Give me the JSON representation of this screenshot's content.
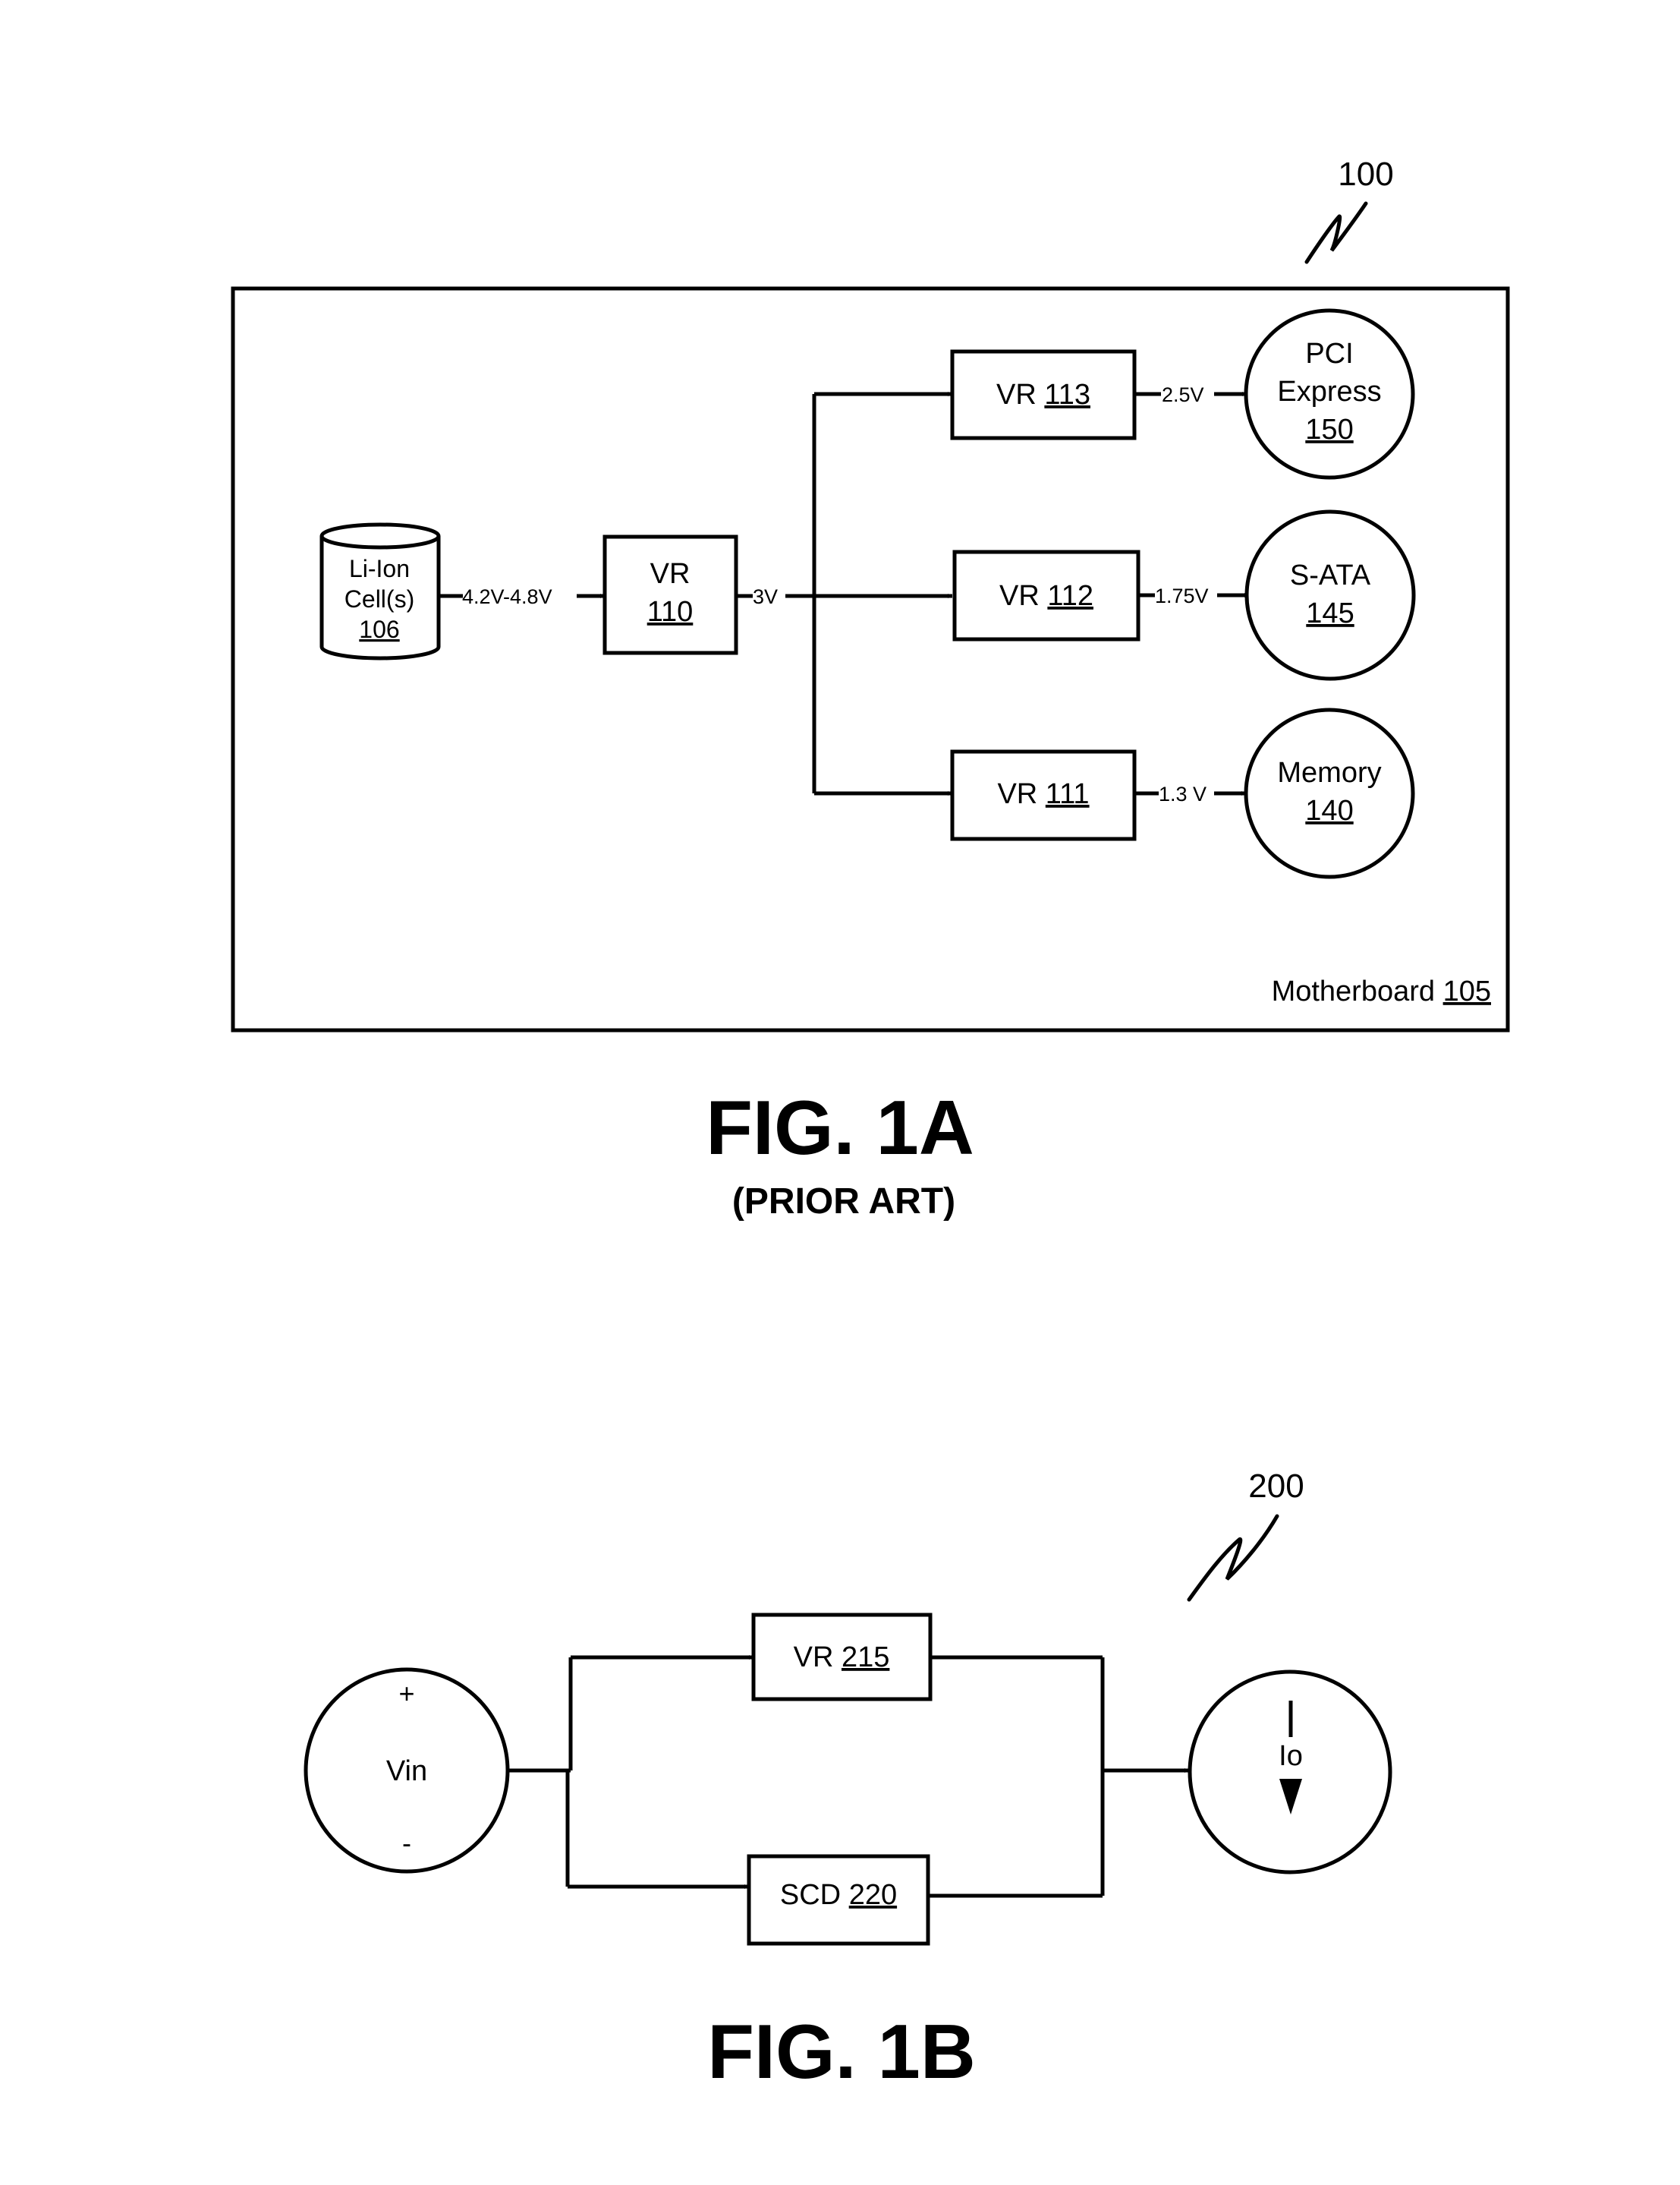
{
  "figure_1a": {
    "reference_numeral": "100",
    "board": {
      "name": "Motherboard",
      "ref": "105"
    },
    "battery": {
      "line1": "Li-Ion",
      "line2": "Cell(s)",
      "ref": "106"
    },
    "battery_output_voltage": "4.2V-4.8V",
    "main_regulator": {
      "name": "VR",
      "ref": "110"
    },
    "main_regulator_output_voltage": "3V",
    "regulators": [
      {
        "name": "VR",
        "ref": "113",
        "output_voltage": "2.5V"
      },
      {
        "name": "VR",
        "ref": "112",
        "output_voltage": "1.75V"
      },
      {
        "name": "VR",
        "ref": "111",
        "output_voltage": "1.3 V"
      }
    ],
    "loads": [
      {
        "line1": "PCI",
        "line2": "Express",
        "ref": "150"
      },
      {
        "line1": "S-ATA",
        "ref": "145"
      },
      {
        "line1": "Memory",
        "ref": "140"
      }
    ],
    "caption": "FIG. 1A",
    "subcaption": "(PRIOR ART)"
  },
  "figure_1b": {
    "reference_numeral": "200",
    "source": {
      "name": "Vin",
      "plus": "+",
      "minus": "-"
    },
    "regulator": {
      "name": "VR",
      "ref": "215"
    },
    "scd": {
      "name": "SCD",
      "ref": "220"
    },
    "load": {
      "name": "Io"
    },
    "caption": "FIG. 1B"
  }
}
